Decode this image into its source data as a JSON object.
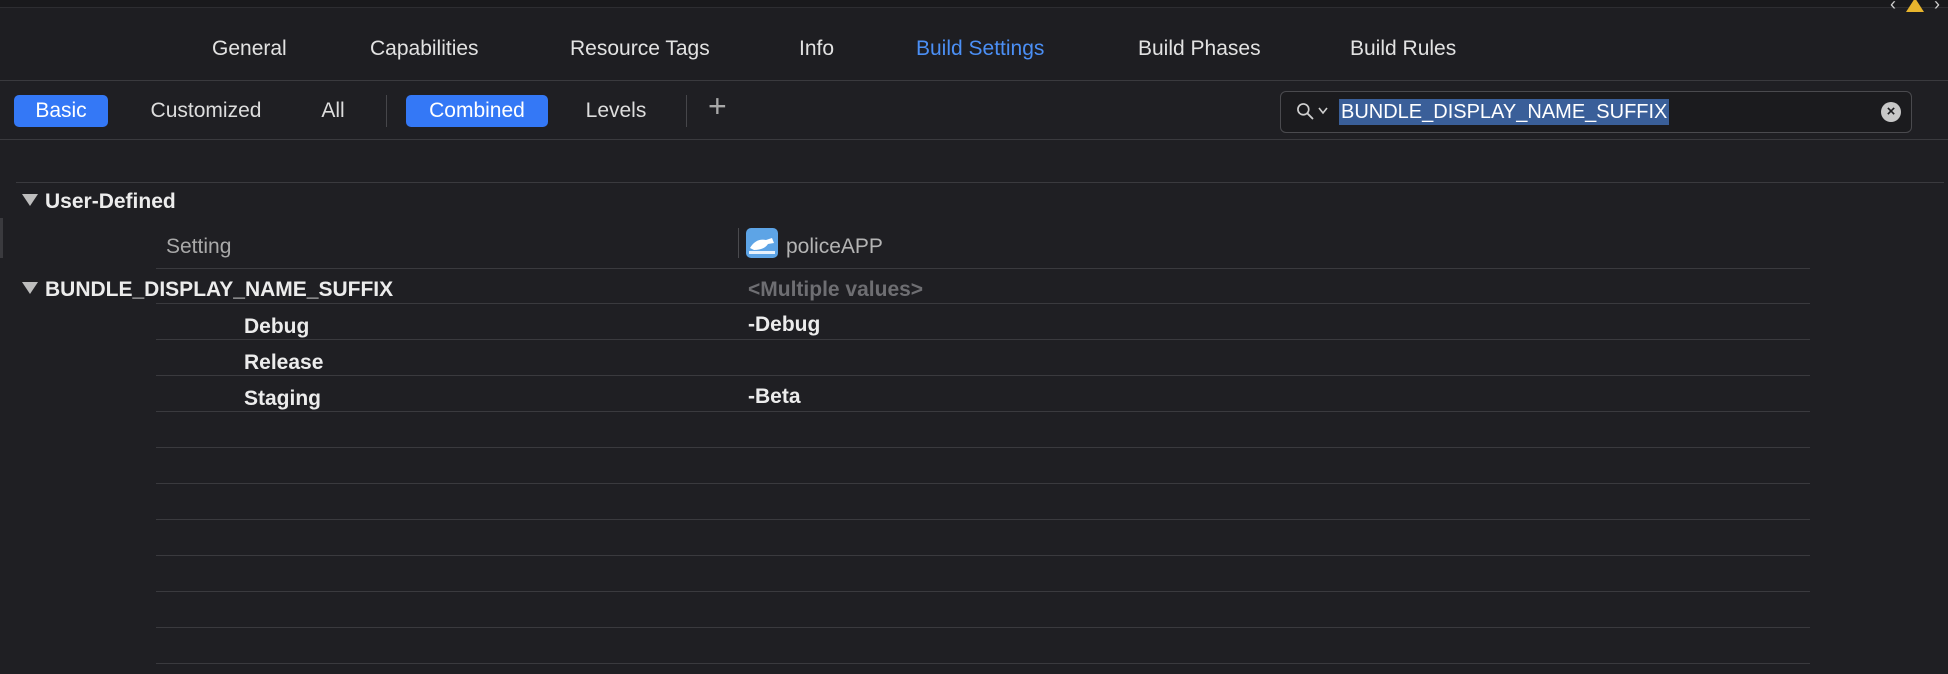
{
  "tabs": [
    {
      "label": "General"
    },
    {
      "label": "Capabilities"
    },
    {
      "label": "Resource Tags"
    },
    {
      "label": "Info"
    },
    {
      "label": "Build Settings",
      "active": true
    },
    {
      "label": "Build Phases"
    },
    {
      "label": "Build Rules"
    }
  ],
  "filters": {
    "basic": "Basic",
    "customized": "Customized",
    "all": "All",
    "combined": "Combined",
    "levels": "Levels",
    "add": "+"
  },
  "search": {
    "value": "BUNDLE_DISPLAY_NAME_SUFFIX",
    "icon": "search-icon"
  },
  "group": {
    "title": "User-Defined",
    "column_label": "Setting",
    "target_name": "policeAPP"
  },
  "setting": {
    "name": "BUNDLE_DISPLAY_NAME_SUFFIX",
    "combined_value": "<Multiple values>",
    "configurations": [
      {
        "name": "Debug",
        "value": "-Debug"
      },
      {
        "name": "Release",
        "value": ""
      },
      {
        "name": "Staging",
        "value": "-Beta"
      }
    ]
  },
  "colors": {
    "accent": "#3478f6",
    "tab_active": "#4b8ff5",
    "background": "#1f1f23"
  }
}
